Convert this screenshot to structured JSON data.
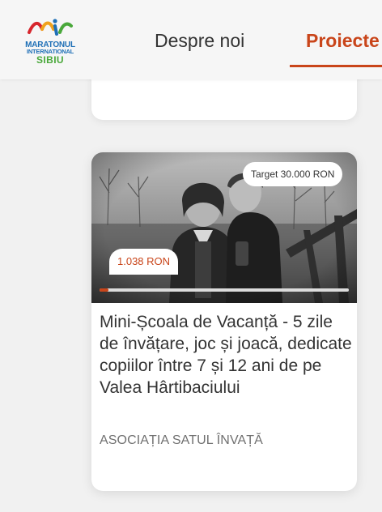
{
  "brand": {
    "logo_line1": "MARATONUL",
    "logo_line2": "INTERNATIONAL",
    "logo_line3": "SIBIU",
    "colors": {
      "blue": "#1e6fb6",
      "green": "#49a83a",
      "red": "#d7262d",
      "orange": "#f0a21d"
    }
  },
  "nav": {
    "items": [
      {
        "label": "Despre noi",
        "active": false
      },
      {
        "label": "Proiecte",
        "active": true
      }
    ],
    "accent_color": "#c9451a"
  },
  "project_card": {
    "image_alt": "Two children outdoors, black and white photo",
    "target_label": "Target 30.000 RON",
    "raised_label": "1.038 RON",
    "progress_fraction": 0.0346,
    "title": "Mini-Școala de Vacanță - 5 zile de învățare, joc și joacă, dedicate copiilor între 7 și 12 ani de pe Valea Hârtibaciului",
    "organization": "ASOCIAȚIA SATUL ÎNVAȚĂ"
  }
}
